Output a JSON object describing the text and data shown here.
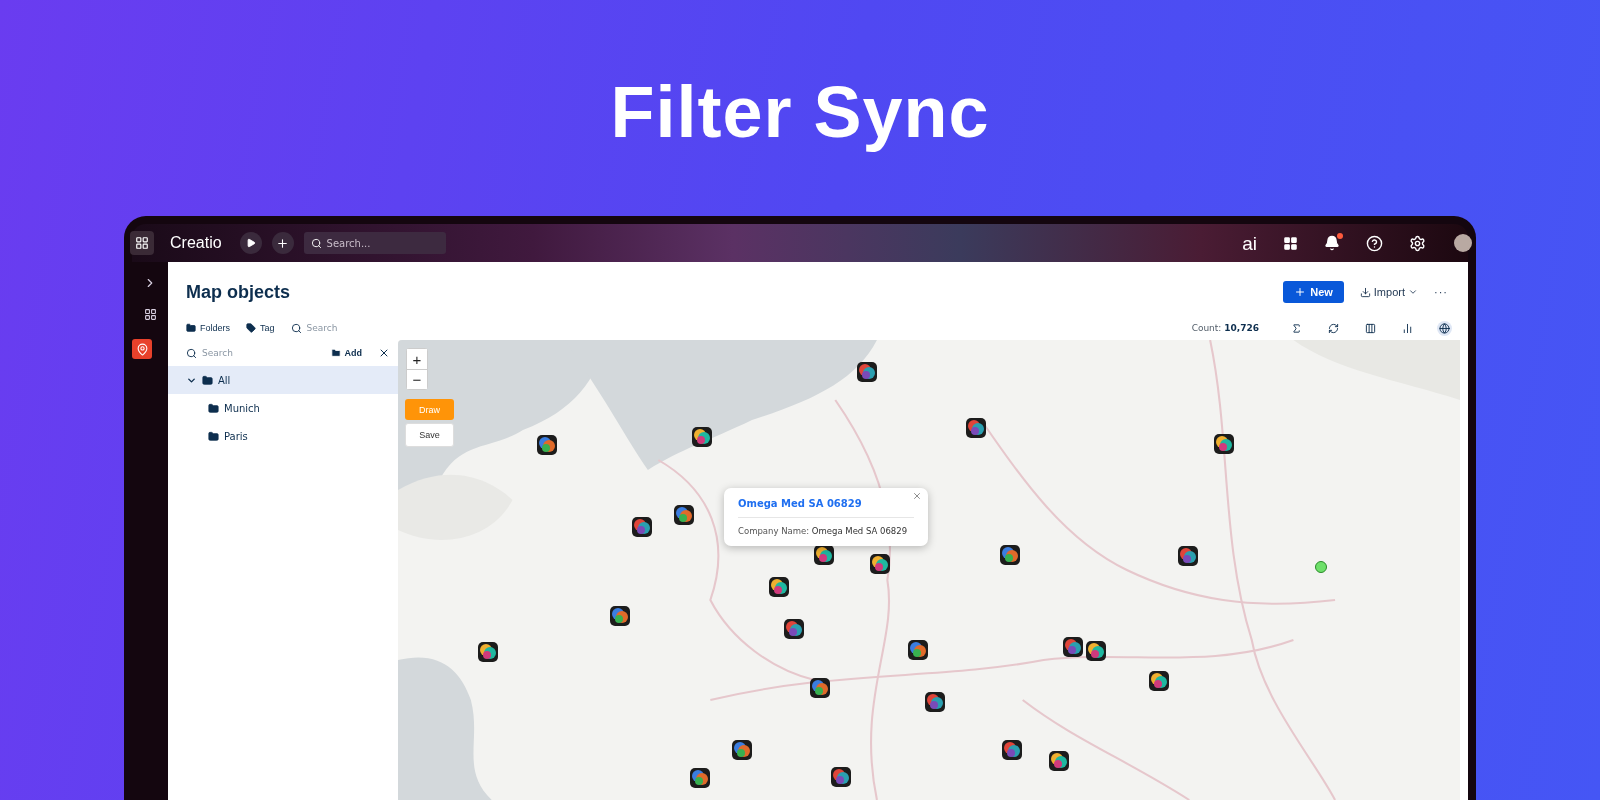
{
  "headline": "Filter Sync",
  "topbar": {
    "logo": "Creatio",
    "search_placeholder": "Search...",
    "ai_button": "ai",
    "notification_unread": true
  },
  "page": {
    "title": "Map objects",
    "new_button": "New",
    "import_button": "Import",
    "more_button": "···"
  },
  "filters": [
    {
      "kind": "folder",
      "label": "Folders"
    },
    {
      "kind": "tag",
      "label": "Tag"
    }
  ],
  "filter_search_placeholder": "Search",
  "count_label": "Count:",
  "count_value": "10,726",
  "folders": {
    "search_placeholder": "Search",
    "add_button": "Add",
    "tree": [
      {
        "label": "All",
        "expanded": true,
        "selected": true,
        "children": [
          {
            "label": "Munich",
            "selected": false
          },
          {
            "label": "Paris",
            "selected": false
          }
        ]
      }
    ]
  },
  "map": {
    "zoom_in": "+",
    "zoom_out": "−",
    "draw_button": "Draw",
    "save_button": "Save",
    "popup": {
      "title": "Omega Med SA 06829",
      "field_label": "Company Name:",
      "field_value": "Omega Med SA 06829"
    }
  }
}
